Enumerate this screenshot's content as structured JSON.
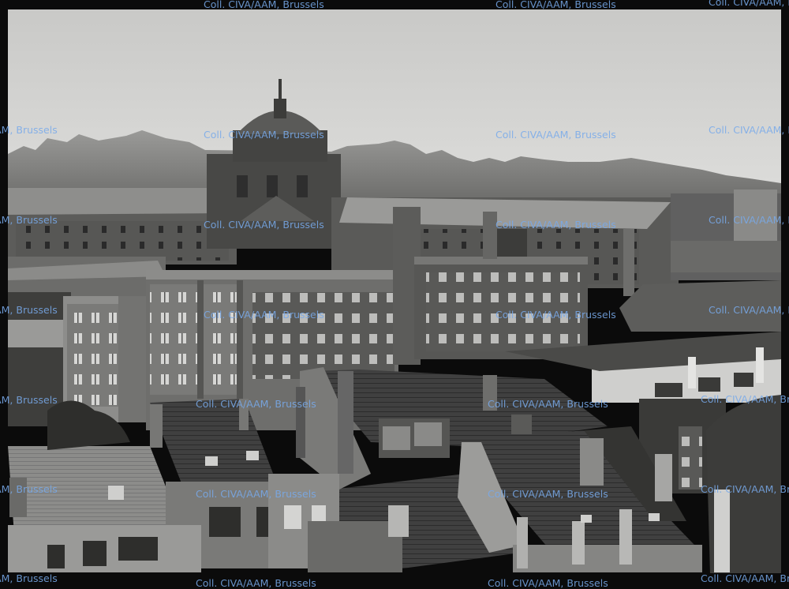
{
  "photo": {
    "subject": "",
    "palette": {
      "sky": "#d2d2d0",
      "roofs": "#3a3a3a",
      "walls": "#6d6d6b",
      "border": "#0b0b0b"
    }
  },
  "watermark": {
    "text": "Coll. CIVA/AAM, Brussels",
    "color": "#78aaeb"
  }
}
